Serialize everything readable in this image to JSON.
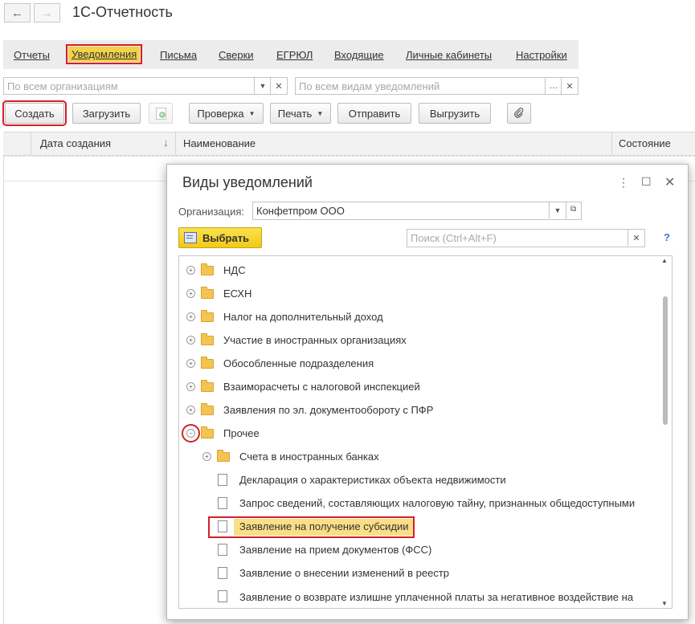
{
  "app": {
    "title": "1С-Отчетность",
    "back_icon": "←",
    "forward_icon": "→"
  },
  "menu": {
    "items": [
      "Отчеты",
      "Уведомления",
      "Письма",
      "Сверки",
      "ЕГРЮЛ",
      "Входящие",
      "Личные кабинеты",
      "Настройки"
    ],
    "active": "Уведомления"
  },
  "filters": {
    "organizations_placeholder": "По всем организациям",
    "kinds_placeholder": "По всем видам уведомлений"
  },
  "toolbar": {
    "create": "Создать",
    "load": "Загрузить",
    "check": "Проверка",
    "print": "Печать",
    "send": "Отправить",
    "export": "Выгрузить"
  },
  "grid": {
    "columns": [
      "Дата создания",
      "Наименование",
      "Состояние"
    ],
    "sort_indicator": "↓"
  },
  "dialog": {
    "title": "Виды уведомлений",
    "org_label": "Организация:",
    "org_value": "Конфетпром ООО",
    "select_button": "Выбрать",
    "search_placeholder": "Поиск (Ctrl+Alt+F)",
    "help": "?",
    "tree": [
      {
        "label": "НДС",
        "type": "folder",
        "expanded": false
      },
      {
        "label": "ЕСХН",
        "type": "folder",
        "expanded": false
      },
      {
        "label": "Налог на дополнительный доход",
        "type": "folder",
        "expanded": false
      },
      {
        "label": "Участие в иностранных организациях",
        "type": "folder",
        "expanded": false
      },
      {
        "label": "Обособленные подразделения",
        "type": "folder",
        "expanded": false
      },
      {
        "label": "Взаиморасчеты с налоговой инспекцией",
        "type": "folder",
        "expanded": false
      },
      {
        "label": "Заявления по эл. документообороту с ПФР",
        "type": "folder",
        "expanded": false
      },
      {
        "label": "Прочее",
        "type": "folder",
        "expanded": true
      },
      {
        "label": "Счета в иностранных банках",
        "type": "folder",
        "expanded": false
      },
      {
        "label": "Декларация о характеристиках объекта недвижимости",
        "type": "document"
      },
      {
        "label": "Запрос сведений, составляющих налоговую тайну, признанных общедоступными",
        "type": "document"
      },
      {
        "label": "Заявление на получение субсидии",
        "type": "document",
        "selected": true
      },
      {
        "label": "Заявление на прием документов (ФСС)",
        "type": "document"
      },
      {
        "label": "Заявление о внесении изменений в реестр",
        "type": "document"
      },
      {
        "label": "Заявление о возврате излишне уплаченной платы за негативное воздействие на окружающую среду",
        "type": "document"
      }
    ]
  },
  "colors": {
    "accent_yellow": "#f3d24b",
    "highlight_red": "#d3202a",
    "button_yellow": "#f1ca18"
  }
}
